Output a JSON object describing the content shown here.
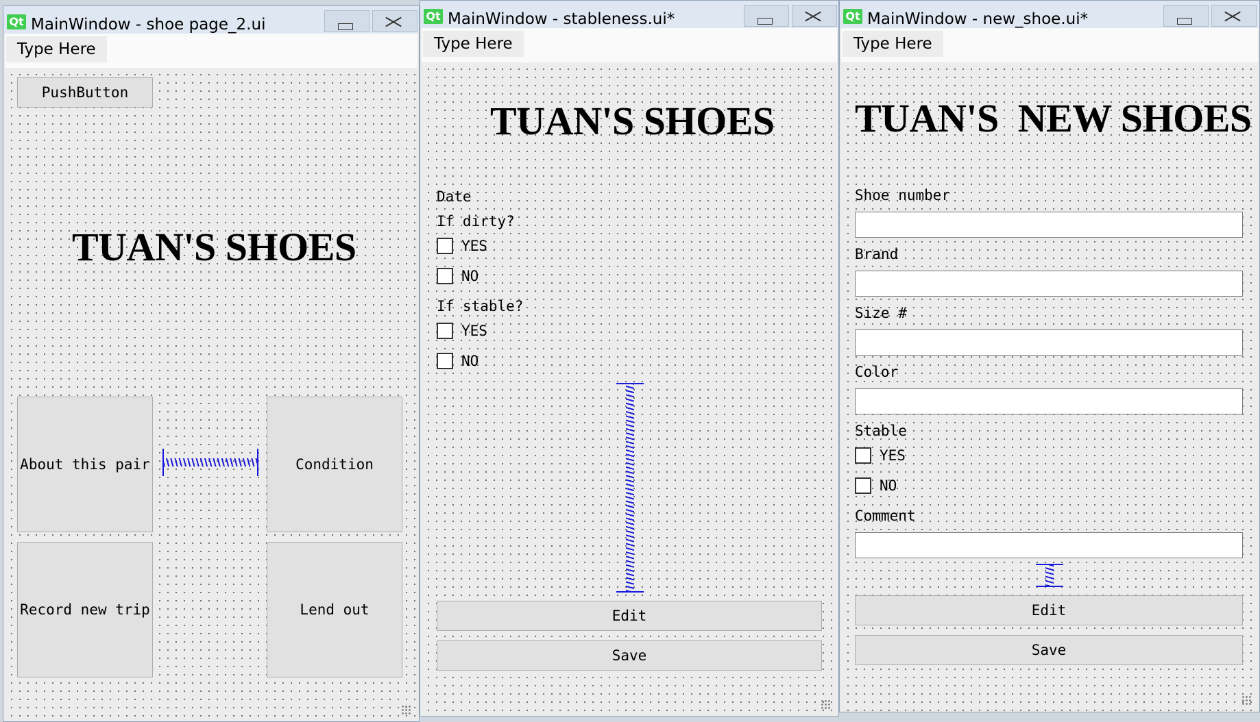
{
  "app": {
    "logo_text": "Qt"
  },
  "windows": [
    {
      "title": "MainWindow - shoe page_2.ui",
      "menu": "Type Here",
      "push_button": "PushButton",
      "heading": "TUAN'S SHOES",
      "buttons": [
        "About this pair",
        "Condition",
        "Record new trip",
        "Lend out"
      ]
    },
    {
      "title": "MainWindow - stableness.ui*",
      "menu": "Type Here",
      "heading": "TUAN'S SHOES",
      "labels": {
        "date": "Date",
        "dirty": "If dirty?",
        "stable": "If stable?"
      },
      "checkboxes": [
        "YES",
        "NO",
        "YES",
        "NO"
      ],
      "buttons": {
        "edit": "Edit",
        "save": "Save"
      }
    },
    {
      "title": "MainWindow - new_shoe.ui*",
      "menu": "Type Here",
      "heading": "TUAN'S  NEW SHOES",
      "fields": {
        "shoe_number": "Shoe number",
        "brand": "Brand",
        "size": "Size #",
        "color": "Color",
        "stable": "Stable",
        "comment": "Comment"
      },
      "checkboxes": [
        "YES",
        "NO"
      ],
      "buttons": {
        "edit": "Edit",
        "save": "Save"
      }
    }
  ],
  "colors": {
    "spacer": "#1a1add",
    "qt_logo": "#41cd52",
    "titlebar": "#dfe8f2"
  }
}
